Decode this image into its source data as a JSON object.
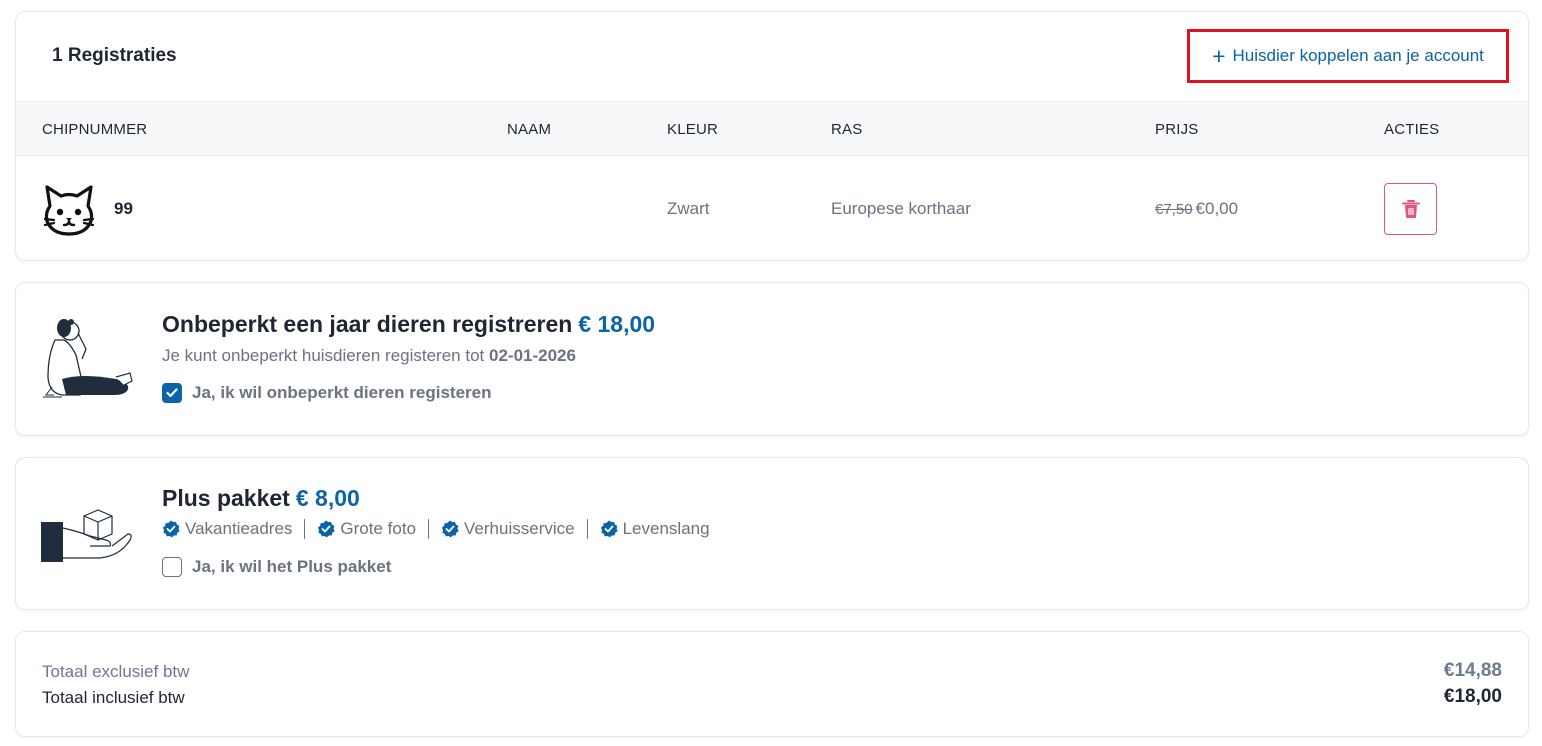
{
  "registrations": {
    "title": "1 Registraties",
    "link_plus": "+",
    "link_label": "Huisdier koppelen aan je account",
    "columns": [
      "CHIPNUMMER",
      "NAAM",
      "KLEUR",
      "RAS",
      "PRIJS",
      "ACTIES"
    ],
    "rows": [
      {
        "icon": "cat-icon",
        "chipnummer": "99",
        "naam": "",
        "kleur": "Zwart",
        "ras": "Europese korthaar",
        "prijs_oud": "€7,50",
        "prijs": "€0,00"
      }
    ]
  },
  "unlimited": {
    "title": "Onbeperkt een jaar dieren registreren",
    "price": "€ 18,00",
    "desc_prefix": "Je kunt onbeperkt huisdieren registeren tot",
    "desc_date": "02-01-2026",
    "checkbox_label": "Ja, ik wil onbeperkt dieren registeren",
    "checked": true
  },
  "plus": {
    "title": "Plus pakket",
    "price": "€ 8,00",
    "features": [
      "Vakantieadres",
      "Grote foto",
      "Verhuisservice",
      "Levenslang"
    ],
    "checkbox_label": "Ja, ik wil het Plus pakket",
    "checked": false
  },
  "totals": {
    "excl_label": "Totaal exclusief btw",
    "excl_value": "€14,88",
    "incl_label": "Totaal inclusief btw",
    "incl_value": "€18,00"
  },
  "colors": {
    "accent": "#0b63a8",
    "highlight_border": "#e0141e",
    "delete": "#e0567a",
    "muted_text": "#6b7280"
  }
}
